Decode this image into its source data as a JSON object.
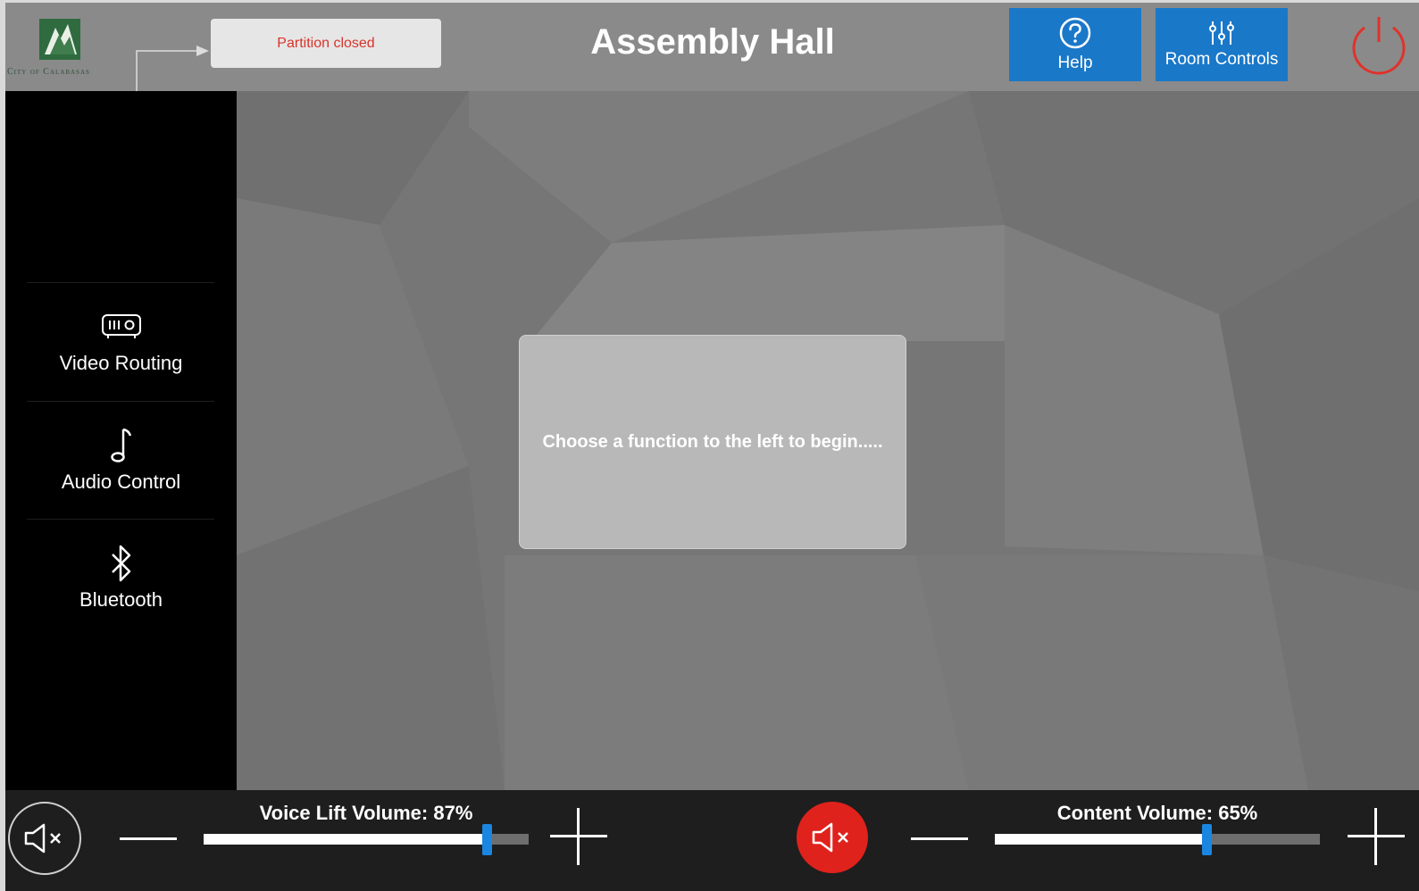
{
  "header": {
    "logo_text": "City of Calabasas",
    "partition_status": "Partition closed",
    "room_title": "Assembly Hall",
    "help_label": "Help",
    "room_controls_label": "Room Controls",
    "accent_color": "#1a78c9",
    "power_icon": "power-icon"
  },
  "sidebar": {
    "items": [
      {
        "label": "Video Routing",
        "icon": "projector-icon"
      },
      {
        "label": "Audio Control",
        "icon": "music-note-icon"
      },
      {
        "label": "Bluetooth",
        "icon": "bluetooth-icon"
      }
    ]
  },
  "main": {
    "prompt": "Choose a function to the left to begin....."
  },
  "footer": {
    "voice_lift": {
      "label": "Voice Lift Volume: 87%",
      "level": 0.87,
      "muted": false
    },
    "content": {
      "label": "Content Volume: 65%",
      "level": 0.65,
      "muted": true,
      "mute_color": "#e0221c"
    }
  }
}
